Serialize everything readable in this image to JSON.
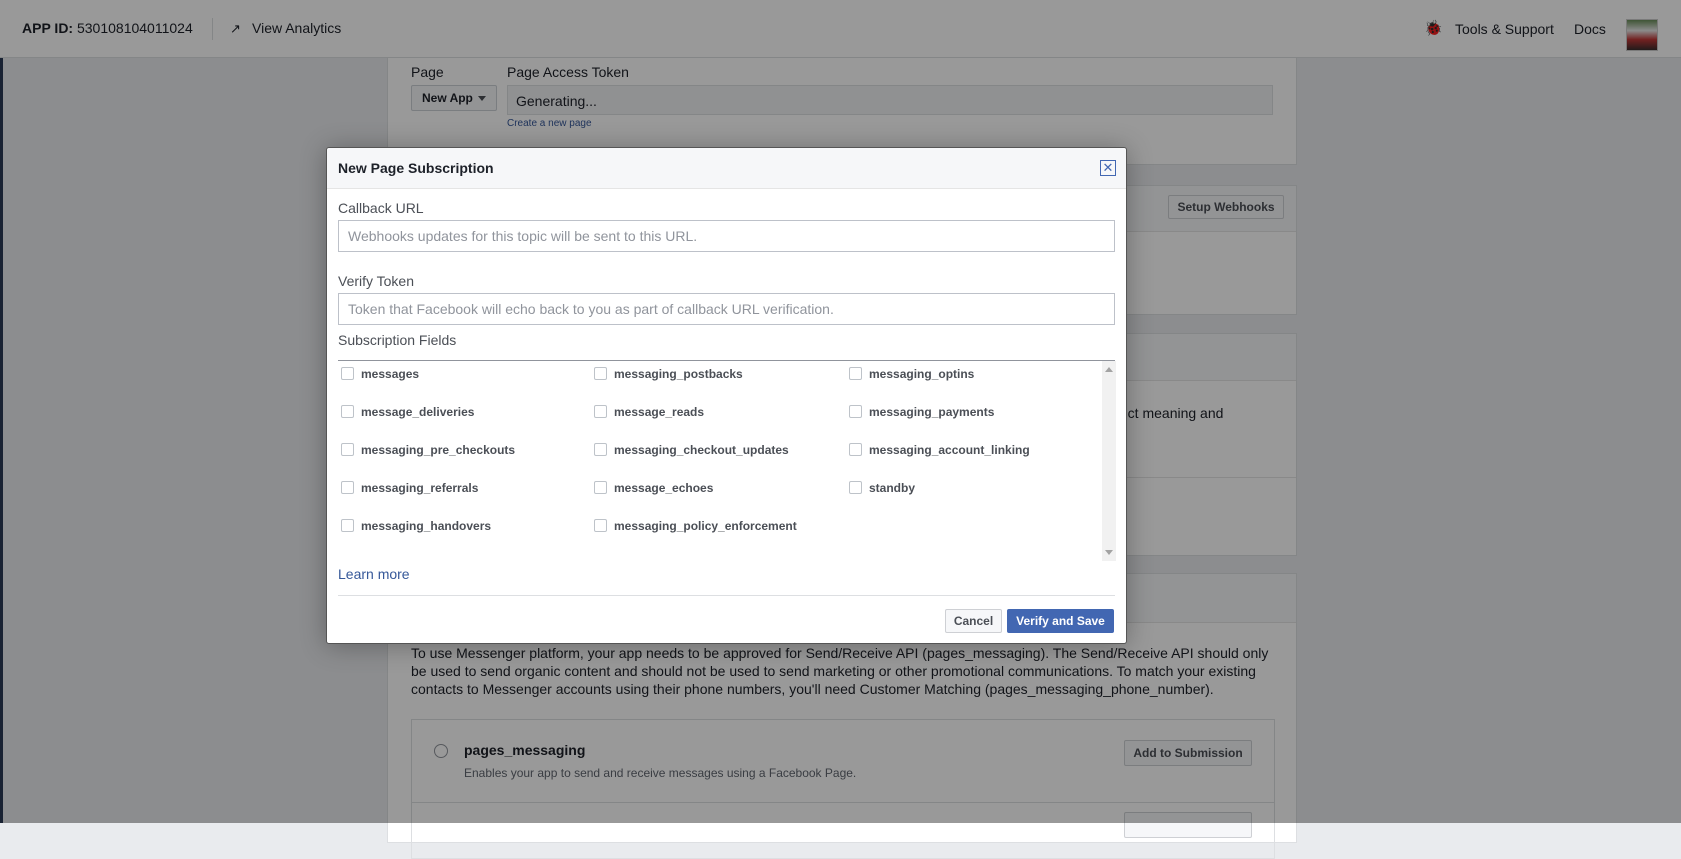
{
  "topbar": {
    "app_id_label": "APP ID:",
    "app_id": "530108104011024",
    "view_analytics": "View Analytics",
    "tools_support": "Tools & Support",
    "docs": "Docs"
  },
  "page_token_card": {
    "page_label": "Page",
    "token_label": "Page Access Token",
    "page_select": "New App",
    "token_value": "Generating...",
    "create_page_link": "Create a new page"
  },
  "webhooks_card": {
    "setup_button": "Setup Webhooks"
  },
  "nlp_card": {
    "partial_text": "tect meaning and"
  },
  "review_card": {
    "paragraph": "To use Messenger platform, your app needs to be approved for Send/Receive API (pages_messaging). The Send/Receive API should only be used to send organic content and should not be used to send marketing or other promotional communications. To match your existing contacts to Messenger accounts using their phone numbers, you'll need Customer Matching (pages_messaging_phone_number).",
    "permission_name": "pages_messaging",
    "permission_desc": "Enables your app to send and receive messages using a Facebook Page.",
    "add_button": "Add to Submission"
  },
  "modal": {
    "title": "New Page Subscription",
    "callback_label": "Callback URL",
    "callback_value": "",
    "callback_placeholder": "Webhooks updates for this topic will be sent to this URL.",
    "verify_label": "Verify Token",
    "verify_value": "",
    "verify_placeholder": "Token that Facebook will echo back to you as part of callback URL verification.",
    "subscription_label": "Subscription Fields",
    "fields": [
      [
        "messages",
        "messaging_postbacks",
        "messaging_optins"
      ],
      [
        "message_deliveries",
        "message_reads",
        "messaging_payments"
      ],
      [
        "messaging_pre_checkouts",
        "messaging_checkout_updates",
        "messaging_account_linking"
      ],
      [
        "messaging_referrals",
        "message_echoes",
        "standby"
      ],
      [
        "messaging_handovers",
        "messaging_policy_enforcement"
      ]
    ],
    "learn_more": "Learn more",
    "cancel": "Cancel",
    "verify_save": "Verify and Save"
  }
}
